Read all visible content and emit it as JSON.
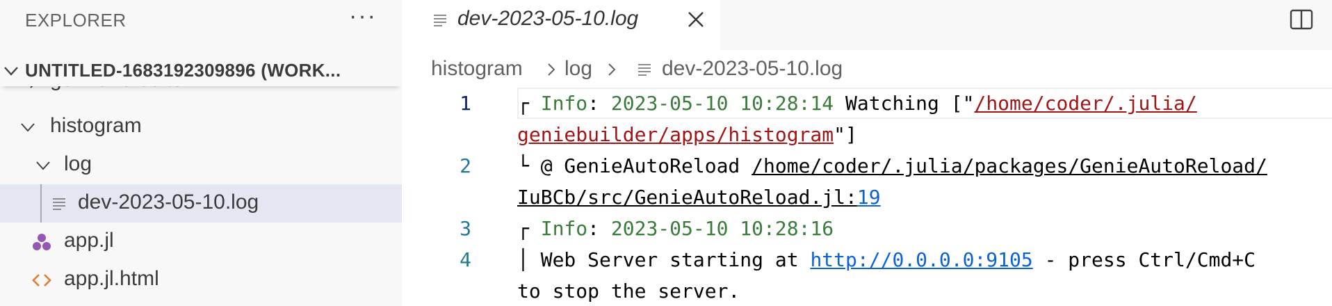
{
  "sidebar": {
    "title": "EXPLORER",
    "more_icon": "more-icon",
    "workspace": "UNTITLED-1683192309896 (WORK...",
    "items": [
      {
        "label": "germancredits",
        "icon": "chevron-right-icon"
      },
      {
        "label": "histogram",
        "icon": "chevron-down-icon"
      },
      {
        "label": "log",
        "icon": "chevron-down-icon"
      },
      {
        "label": "dev-2023-05-10.log",
        "icon": "text-file-icon"
      },
      {
        "label": "app.jl",
        "icon": "julia-icon"
      },
      {
        "label": "app.jl.html",
        "icon": "html-brackets-icon"
      }
    ]
  },
  "editor": {
    "tab": {
      "label": "dev-2023-05-10.log",
      "icon": "text-file-icon",
      "close_icon": "close-icon"
    },
    "split_icon": "split-editor-icon",
    "breadcrumb": [
      "histogram",
      "log",
      "dev-2023-05-10.log"
    ],
    "line_numbers": [
      "1",
      "2",
      "3",
      "4"
    ],
    "lines": {
      "l1a_prefix": "┌ ",
      "l1a_info": "Info",
      "l1a_colon": ": ",
      "l1a_ts": "2023-05-10 10:28:14",
      "l1a_text": " Watching [\"",
      "l1a_path": "/home/coder/.julia/",
      "l1b_path": "geniebuilder/apps/histogram",
      "l1b_end": "\"]",
      "l2a_prefix": "└ @ GenieAutoReload ",
      "l2a_path": "/home/coder/.julia/packages/GenieAutoReload/",
      "l2b_path": "IuBCb/src/GenieAutoReload.jl:",
      "l2b_num": "19",
      "l3_prefix": "┌ ",
      "l3_info": "Info",
      "l3_colon": ": ",
      "l3_ts": "2023-05-10 10:28:16",
      "l4a_prefix": "│ Web Server starting at ",
      "l4a_link": "http://0.0.0.0:9105",
      "l4a_end": " - press Ctrl/Cmd+C",
      "l4b": "to stop the server."
    }
  },
  "colors": {
    "sidebar_bg": "#f8f8f8",
    "selected_bg": "#e4e6f1",
    "info_green": "#3a7a3a",
    "path_red": "#a31515",
    "link_blue": "#0b62d6",
    "line_number": "#237893"
  }
}
